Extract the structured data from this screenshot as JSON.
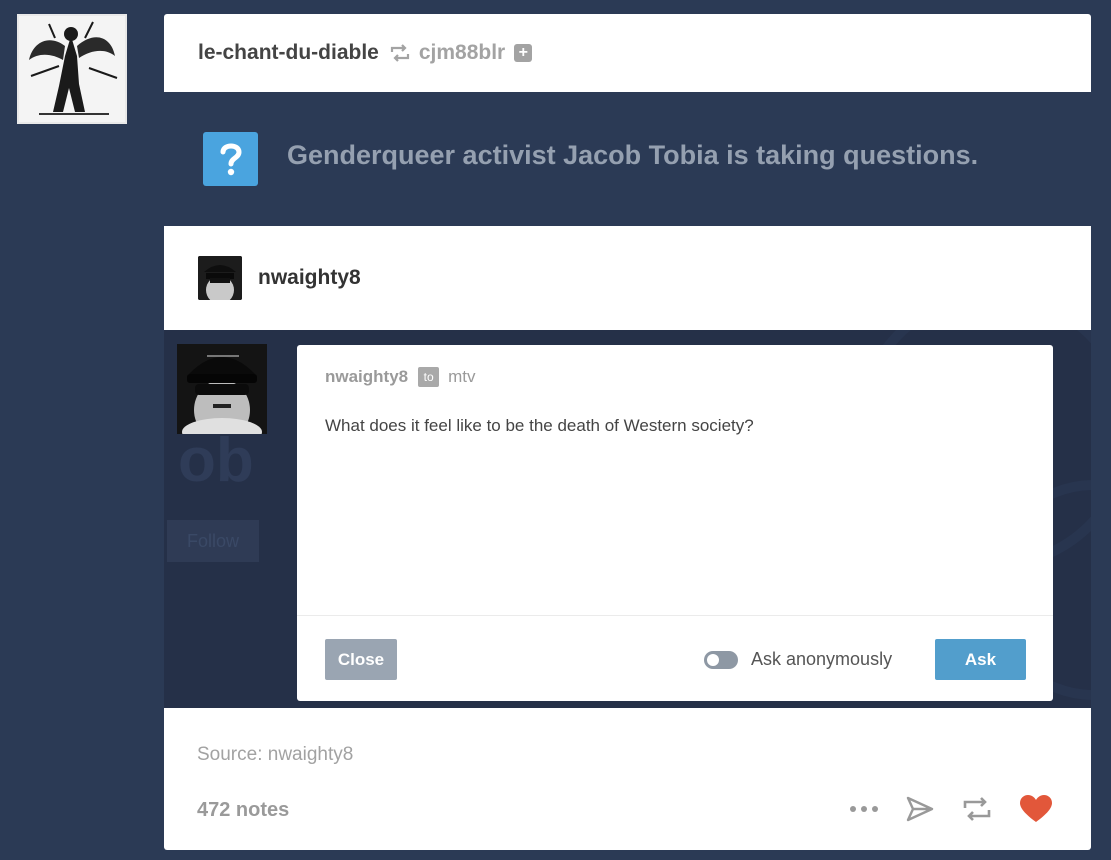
{
  "header": {
    "username": "le-chant-du-diable",
    "reblogged_from": "cjm88blr"
  },
  "banner": {
    "text": "Genderqueer activist Jacob Tobia is taking questions."
  },
  "ask_header": {
    "username": "nwaighty8"
  },
  "ask_modal": {
    "from": "nwaighty8",
    "to_badge": "to",
    "to": "mtv",
    "question": "What does it feel like to be the death of Western society?",
    "close_label": "Close",
    "anon_label": "Ask anonymously",
    "ask_label": "Ask"
  },
  "background": {
    "ghost_text": "ob",
    "follow_label": "Follow"
  },
  "footer": {
    "source": "Source: nwaighty8",
    "notes": "472 notes"
  },
  "colors": {
    "page_bg": "#2b3a55",
    "accent_blue": "#529ecc",
    "like_red": "#e2573a"
  },
  "icons": [
    "reblog-icon",
    "plus-icon",
    "question-icon",
    "more-icon",
    "send-icon",
    "reblog-icon",
    "heart-icon"
  ]
}
